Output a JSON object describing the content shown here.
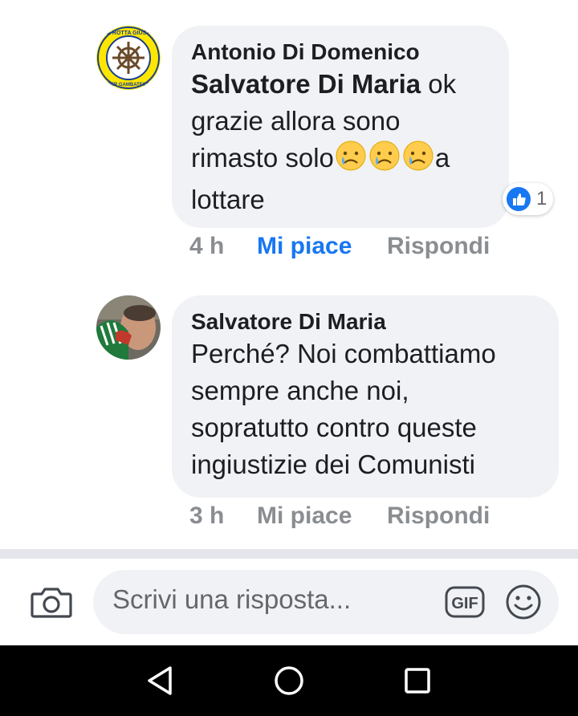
{
  "comments": [
    {
      "author": "Antonio Di Domenico",
      "mention": "Salvatore Di Maria",
      "lines": [
        " ok",
        "grazie allora sono",
        "rimasto solo",
        "a",
        "lottare"
      ],
      "reaction_count": "1",
      "meta": {
        "time": "4 h",
        "like": "Mi piace",
        "reply": "Rispondi"
      },
      "avatar_badge": {
        "top_text": "LA ROTTA GIUSTA",
        "bottom_text": "PER GAMBATESA"
      }
    },
    {
      "author": "Salvatore Di Maria",
      "lines": [
        "Perché? Noi combattiamo",
        "sempre anche noi,",
        "sopratutto contro queste",
        "ingiustizie dei Comunisti"
      ],
      "meta": {
        "time": "3 h",
        "like": "Mi piace",
        "reply": "Rispondi"
      }
    }
  ],
  "composer": {
    "placeholder": "Scrivi una risposta...",
    "gif_label": "GIF"
  },
  "colors": {
    "accent": "#1877f2",
    "bubble": "#f0f2f5",
    "meta": "#8a8d91"
  },
  "icons": [
    "camera-icon",
    "gif-icon",
    "smiley-icon",
    "back-icon",
    "home-icon",
    "recents-icon",
    "like-reaction-icon",
    "crying-emoji-icon"
  ]
}
